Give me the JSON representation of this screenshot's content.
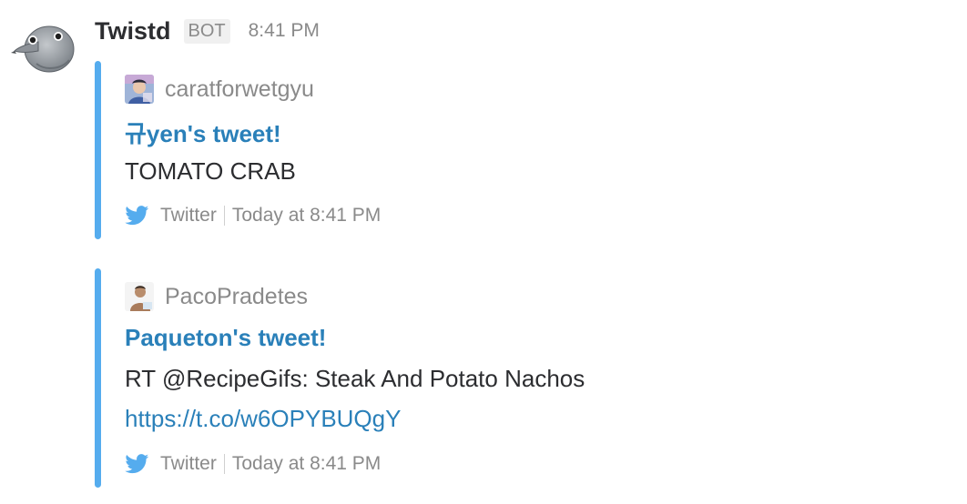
{
  "message": {
    "sender": "Twistd",
    "badge": "BOT",
    "time": "8:41 PM",
    "avatar_icon": "pigeon-icon"
  },
  "attachments": [
    {
      "author": "caratforwetgyu",
      "title": "규yen's tweet!",
      "text": "TOMATO CRAB",
      "link": "",
      "footer_source": "Twitter",
      "footer_time": "Today at 8:41 PM"
    },
    {
      "author": "PacoPradetes",
      "title": "Paqueton's tweet!",
      "text": "RT @RecipeGifs: Steak And Potato Nachos",
      "link": "https://t.co/w6OPYBUQgY",
      "footer_source": "Twitter",
      "footer_time": "Today at 8:41 PM"
    }
  ],
  "colors": {
    "attachment_bar": "#55acee",
    "link": "#2a80b9",
    "text": "#2c2d30",
    "muted": "#8a8a8a"
  }
}
